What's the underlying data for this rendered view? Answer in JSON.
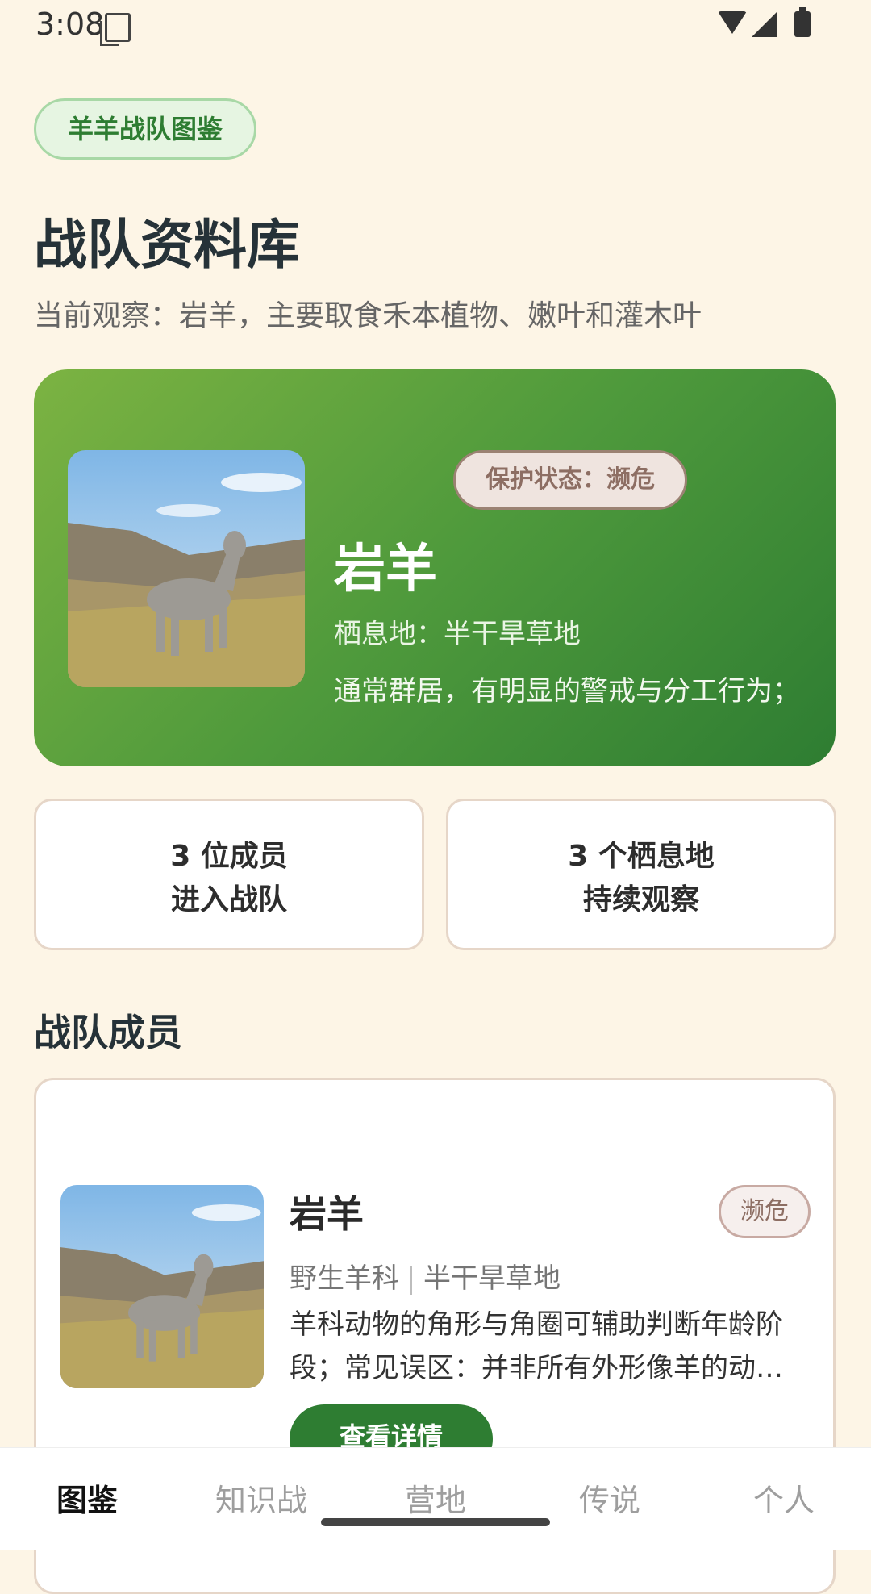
{
  "status_bar": {
    "time": "3:08"
  },
  "header": {
    "chip": "羊羊战队图鉴",
    "title": "战队资料库",
    "subtitle": "当前观察：岩羊，主要取食禾本植物、嫩叶和灌木叶"
  },
  "hero": {
    "status_badge": "保护状态：濒危",
    "name": "岩羊",
    "habitat": "栖息地：半干旱草地",
    "description": "通常群居，有明显的警戒与分工行为；融合羊角力量与蹄部抓地能力，可在险"
  },
  "stats": [
    {
      "line1": "3 位成员",
      "line2": "进入战队"
    },
    {
      "line1": "3 个栖息地",
      "line2": "持续观察"
    }
  ],
  "members_section": {
    "title": "战队成员"
  },
  "member": {
    "name": "岩羊",
    "tag": "濒危",
    "family": "野生羊科",
    "habitat": "半干旱草地",
    "description": "羊科动物的角形与角圈可辅助判断年龄阶段；常见误区：并非所有外形像羊的动物都属于羊科",
    "button": "查看详情"
  },
  "tabs": [
    {
      "label": "图鉴",
      "active": true
    },
    {
      "label": "知识战",
      "active": false
    },
    {
      "label": "营地",
      "active": false
    },
    {
      "label": "传说",
      "active": false
    },
    {
      "label": "个人",
      "active": false
    }
  ],
  "colors": {
    "accent": "#2e7d32",
    "background": "#fdf5e6",
    "status": "#8d6e63"
  }
}
